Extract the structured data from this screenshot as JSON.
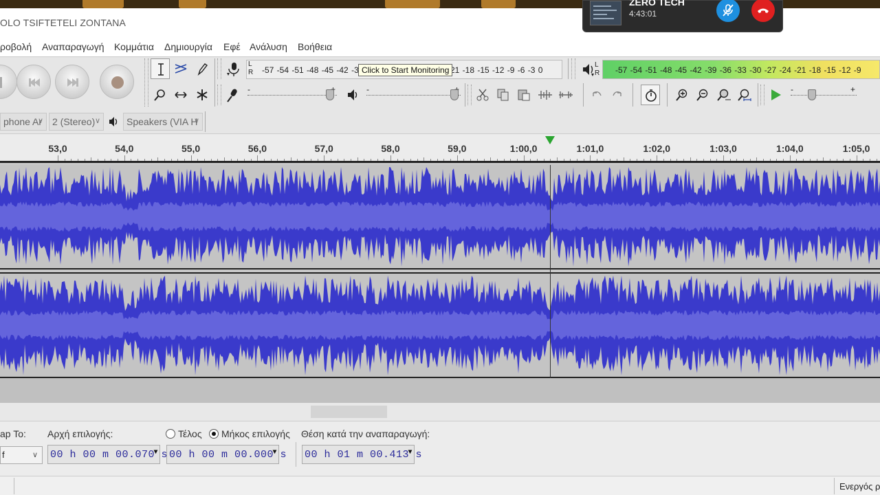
{
  "window": {
    "title": "OLO TSIFTETELI ZONTANA"
  },
  "call": {
    "name": "ZERO TECH",
    "duration": "4:43:01"
  },
  "menu": [
    "ροβολή",
    "Αναπαραγωγή",
    "Κομμάτια",
    "Δημιουργία",
    "Εφέ",
    "Ανάλυση",
    "Βοήθεια"
  ],
  "meters": {
    "record_ticks": "-57 -54 -51 -48 -45 -42 -3",
    "record_ticks_right": "21 -18 -15 -12 -9 -6 -3 0",
    "play_ticks": "-57 -54 -51 -48 -45 -42 -39 -36 -33 -30 -27 -24 -21 -18 -15 -12 -9",
    "lr_label": "L\nR",
    "tooltip": "Click to Start Monitoring"
  },
  "slider_signs": {
    "minus": "-",
    "plus": "+"
  },
  "devices": {
    "input": "phone Ar",
    "channels": "2 (Stereo)",
    "output": "Speakers (VIA H"
  },
  "ruler": {
    "labels": [
      "53,0",
      "54,0",
      "55,0",
      "56,0",
      "57,0",
      "58,0",
      "59,0",
      "1:00,0",
      "1:01,0",
      "1:02,0",
      "1:03,0",
      "1:04,0",
      "1:05,0"
    ]
  },
  "selection": {
    "snap_label": "ap To:",
    "snap_value": "f",
    "start_label": "Αρχή επιλογής:",
    "end_label": "Τέλος",
    "length_label": "Μήκος επιλογής",
    "position_label": "Θέση κατά την αναπαραγωγή:",
    "start_value": "00 h 00 m 00.070 s",
    "length_value": "00 h 00 m 00.000 s",
    "position_value": "00 h 01 m 00.413 s",
    "mode": "length"
  },
  "status": {
    "text": "Ενεργός ρ"
  },
  "colors": {
    "waveform": "#3a3acb",
    "waveform_rms": "#6464dc",
    "track_bg": "#c4c4c4",
    "playhead": "#2aa530"
  }
}
